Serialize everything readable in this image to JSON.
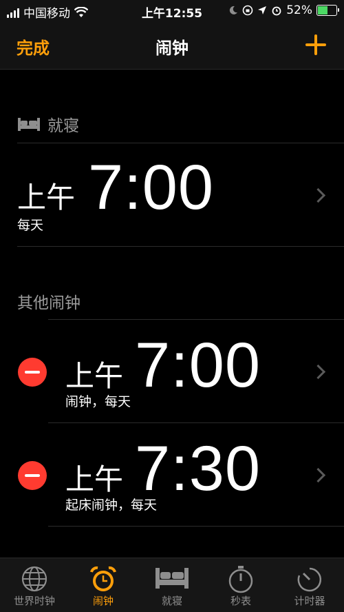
{
  "status_bar": {
    "carrier": "中国移动",
    "time": "上午12:55",
    "battery_percent": "52%",
    "battery_level": 0.52,
    "battery_color": "#4cd964"
  },
  "nav": {
    "done_label": "完成",
    "title": "闹钟",
    "add_icon": "plus-icon",
    "accent_color": "#ff9f0a"
  },
  "bedtime": {
    "header": "就寝",
    "icon": "bed-icon",
    "alarm": {
      "ampm": "上午",
      "time": "7:00",
      "subtitle": "每天"
    }
  },
  "other": {
    "header": "其他闹钟",
    "alarms": [
      {
        "ampm": "上午",
        "time": "7:00",
        "subtitle": "闹钟，每天"
      },
      {
        "ampm": "上午",
        "time": "7:30",
        "subtitle": "起床闹钟，每天"
      }
    ]
  },
  "tab_bar": {
    "tabs": [
      {
        "label": "世界时钟",
        "icon": "globe-icon",
        "active": false
      },
      {
        "label": "闹钟",
        "icon": "alarm-clock-icon",
        "active": true
      },
      {
        "label": "就寝",
        "icon": "bed-icon",
        "active": false
      },
      {
        "label": "秒表",
        "icon": "stopwatch-icon",
        "active": false
      },
      {
        "label": "计时器",
        "icon": "timer-icon",
        "active": false
      }
    ]
  }
}
